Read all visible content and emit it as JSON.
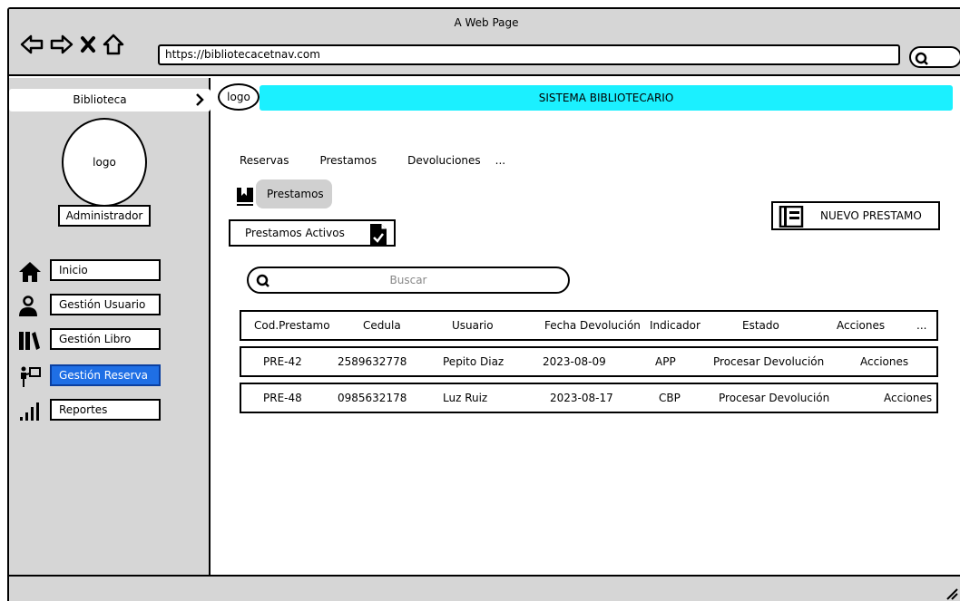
{
  "window": {
    "title": "A Web Page"
  },
  "browser": {
    "url": "https://bibliotecacetnav.com"
  },
  "sidebar": {
    "header": "Biblioteca",
    "logo_text": "logo",
    "role": "Administrador",
    "items": [
      {
        "label": "Inicio",
        "icon": "home-icon"
      },
      {
        "label": "Gestión Usuario",
        "icon": "user-icon"
      },
      {
        "label": "Gestión Libro",
        "icon": "books-icon"
      },
      {
        "label": "Gestión Reserva",
        "icon": "reservation-icon",
        "active": true
      },
      {
        "label": "Reportes",
        "icon": "signal-bars-icon"
      }
    ]
  },
  "header": {
    "logo_text": "logo",
    "title": "SISTEMA BIBLIOTECARIO",
    "accent": "#1bf0ff"
  },
  "tabs": [
    "Reservas",
    "Prestamos",
    "Devoluciones",
    "..."
  ],
  "section": {
    "label": "Prestamos"
  },
  "active_button": {
    "label": "Prestamos Activos"
  },
  "new_button": {
    "label": "NUEVO PRESTAMO"
  },
  "search": {
    "placeholder": "Buscar"
  },
  "table": {
    "columns": [
      "Cod.Prestamo",
      "Cedula",
      "Usuario",
      "Fecha Devolución",
      "Indicador",
      "Estado",
      "Acciones",
      "..."
    ],
    "rows": [
      [
        "PRE-42",
        "2589632778",
        "Pepito Diaz",
        "2023-08-09",
        "APP",
        "Procesar Devolución",
        "Acciones"
      ],
      [
        "PRE-48",
        "0985632178",
        "Luz Ruiz",
        "2023-08-17",
        "CBP",
        "Procesar Devolución",
        "Acciones"
      ]
    ]
  },
  "colors": {
    "active_menu": "#1f6fe5",
    "chrome": "#d6d6d6"
  }
}
